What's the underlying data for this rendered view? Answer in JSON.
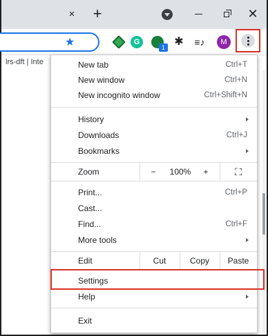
{
  "tabbar": {
    "close_glyph": "×",
    "newtab_glyph": "+",
    "minimize_glyph": "",
    "close_window_glyph": "✕"
  },
  "toolbar": {
    "star_glyph": "★",
    "ext_grammarly": "G",
    "ext_badge": "1",
    "puzzle_glyph": "✱",
    "media_glyph": "≡♪",
    "avatar_letter": "M"
  },
  "bookmarks": {
    "partial_text": "lrs-dft | Inte"
  },
  "menu": {
    "new_tab": {
      "label": "New tab",
      "shortcut": "Ctrl+T"
    },
    "new_window": {
      "label": "New window",
      "shortcut": "Ctrl+N"
    },
    "new_incognito": {
      "label": "New incognito window",
      "shortcut": "Ctrl+Shift+N"
    },
    "history": {
      "label": "History"
    },
    "downloads": {
      "label": "Downloads",
      "shortcut": "Ctrl+J"
    },
    "bookmarks": {
      "label": "Bookmarks"
    },
    "zoom": {
      "label": "Zoom",
      "minus": "−",
      "value": "100%",
      "plus": "+",
      "fullscreen_glyph": "⛶"
    },
    "print": {
      "label": "Print...",
      "shortcut": "Ctrl+P"
    },
    "cast": {
      "label": "Cast..."
    },
    "find": {
      "label": "Find...",
      "shortcut": "Ctrl+F"
    },
    "more_tools": {
      "label": "More tools"
    },
    "edit": {
      "label": "Edit",
      "cut": "Cut",
      "copy": "Copy",
      "paste": "Paste"
    },
    "settings": {
      "label": "Settings"
    },
    "help": {
      "label": "Help"
    },
    "exit": {
      "label": "Exit"
    }
  },
  "colors": {
    "accent": "#1a73e8",
    "highlight_box": "#d93025",
    "titlebar": "#dee1e6",
    "avatar": "#8e24aa"
  }
}
